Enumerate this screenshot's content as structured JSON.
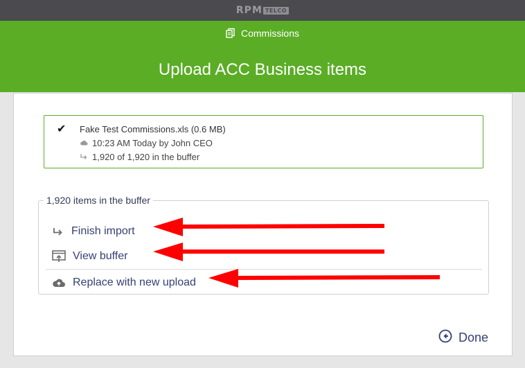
{
  "brand": {
    "logo_main": "RPM",
    "logo_sub": "TELCO"
  },
  "header": {
    "breadcrumb": "Commissions",
    "title": "Upload ACC Business items",
    "color": "#5aad25"
  },
  "file": {
    "name": "Fake Test Commissions.xls (0.6 MB)",
    "uploaded": "10:23 AM Today by John CEO",
    "buffer_status": "1,920 of 1,920 in the buffer"
  },
  "buffer": {
    "legend": "1,920 items in the buffer",
    "actions": [
      {
        "label": "Finish import",
        "icon": "finish-arrow-icon"
      },
      {
        "label": "View buffer",
        "icon": "view-buffer-icon"
      },
      {
        "label": "Replace with new upload",
        "icon": "cloud-upload-icon"
      }
    ]
  },
  "footer": {
    "done_label": "Done",
    "icon": "back-circle-icon"
  },
  "annotation": {
    "arrow_color": "#ff0000"
  }
}
